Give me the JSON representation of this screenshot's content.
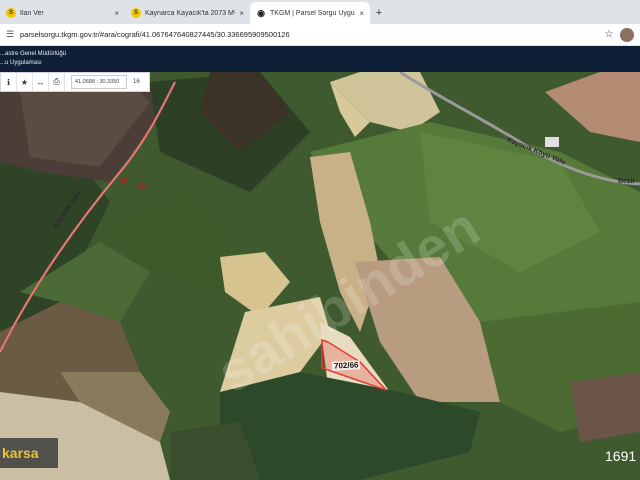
{
  "browser": {
    "tabs": [
      {
        "icon": "S",
        "title": "İlan Ver",
        "active": false
      },
      {
        "icon": "S",
        "title": "Kaynarca Kayacık'ta 2073 M²",
        "active": false
      },
      {
        "icon": "pin",
        "title": "TKGM | Parsel Sorgu Uygulam",
        "active": true
      }
    ],
    "new_tab": "+",
    "close": "×",
    "url": "parselsorgu.tkgm.gov.tr/#ara/cografi/41.067647640827445/30.336695909500126"
  },
  "header": {
    "line1": "...astre Genel Müdürlüğü",
    "line2": "...u Uygulaması"
  },
  "toolbar": {
    "coords": "41.0688 : 30.3350",
    "zoom": "16"
  },
  "map": {
    "parcel_label": "702/66",
    "road_label_1": "Kayacık Yolu",
    "road_label_2": "Kayacık Köyü Yolu",
    "road_label_3": "Bezir",
    "watermark": "sahibinden",
    "brand": "karsa",
    "page_number": "1691"
  },
  "colors": {
    "header_bg": "#0f1f36",
    "parcel_outline": "#e53935",
    "road_line": "#d9534f"
  }
}
